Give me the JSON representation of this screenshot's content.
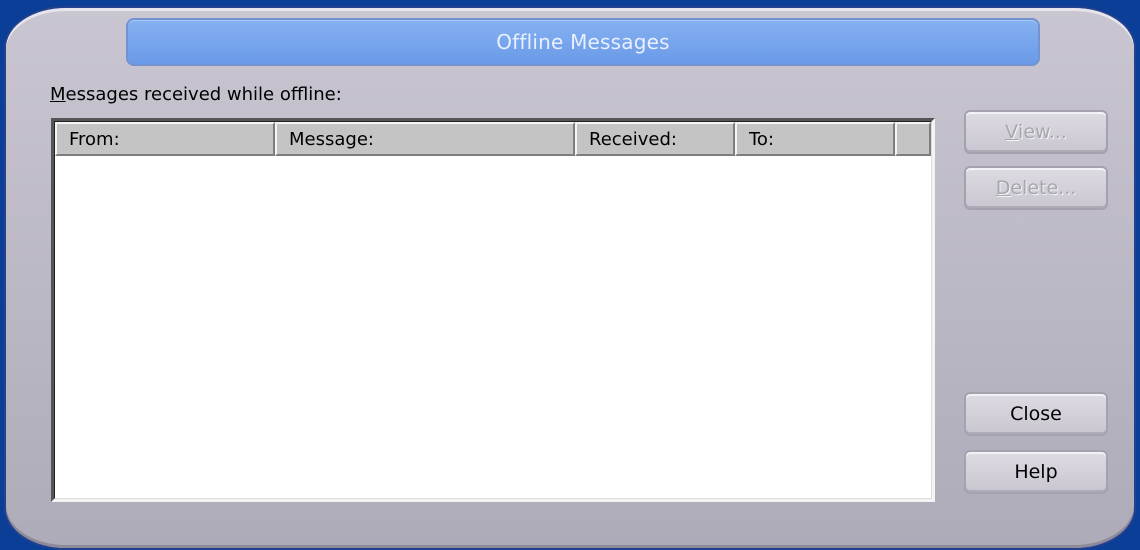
{
  "window": {
    "title": "Offline Messages"
  },
  "label": {
    "accel": "M",
    "rest": "essages received while offline:"
  },
  "table": {
    "columns": [
      "From:",
      "Message:",
      "Received:",
      "To:",
      ""
    ],
    "rows": []
  },
  "buttons": {
    "view": {
      "accel": "V",
      "rest": "iew...",
      "enabled": false
    },
    "delete": {
      "accel": "D",
      "rest": "elete...",
      "enabled": false
    },
    "close": {
      "label": "Close",
      "enabled": true
    },
    "help": {
      "label": "Help",
      "enabled": true
    }
  },
  "colors": {
    "title_bar": "#7aa4ee",
    "frame": "#c0bdc9",
    "desktop": "#0b3e96"
  }
}
